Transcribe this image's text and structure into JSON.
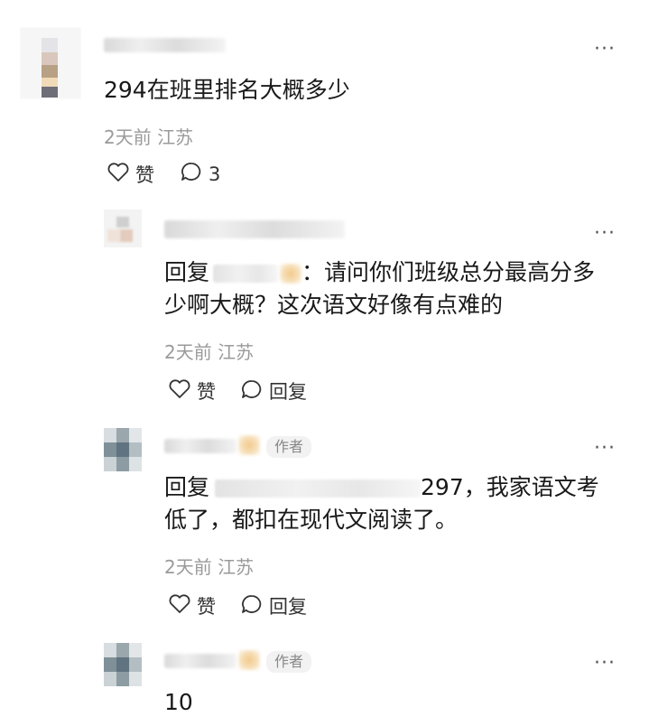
{
  "comment1": {
    "text": "294在班里排名大概多少",
    "time": "2天前",
    "location": "江苏",
    "like_label": "赞",
    "reply_count": "3",
    "more": "···"
  },
  "reply1": {
    "prefix": "回复",
    "text_line1": "：请问你们班级总分最高分多",
    "text_line2": "少啊大概？这次语文好像有点难的",
    "time": "2天前",
    "location": "江苏",
    "like_label": "赞",
    "reply_label": "回复",
    "more": "···"
  },
  "reply2": {
    "author_tag": "作者",
    "prefix": "回复",
    "text_line1": "297，我家语文考",
    "text_line2": "低了，都扣在现代文阅读了。",
    "time": "2天前",
    "location": "江苏",
    "like_label": "赞",
    "reply_label": "回复",
    "more": "···"
  },
  "reply3": {
    "author_tag": "作者",
    "text": "10",
    "more": "···"
  },
  "colors": {
    "meta_gray": "#9a9a9a",
    "text": "#191919",
    "icon": "#333333"
  },
  "icons": [
    "heart-icon",
    "comment-icon",
    "more-icon"
  ]
}
